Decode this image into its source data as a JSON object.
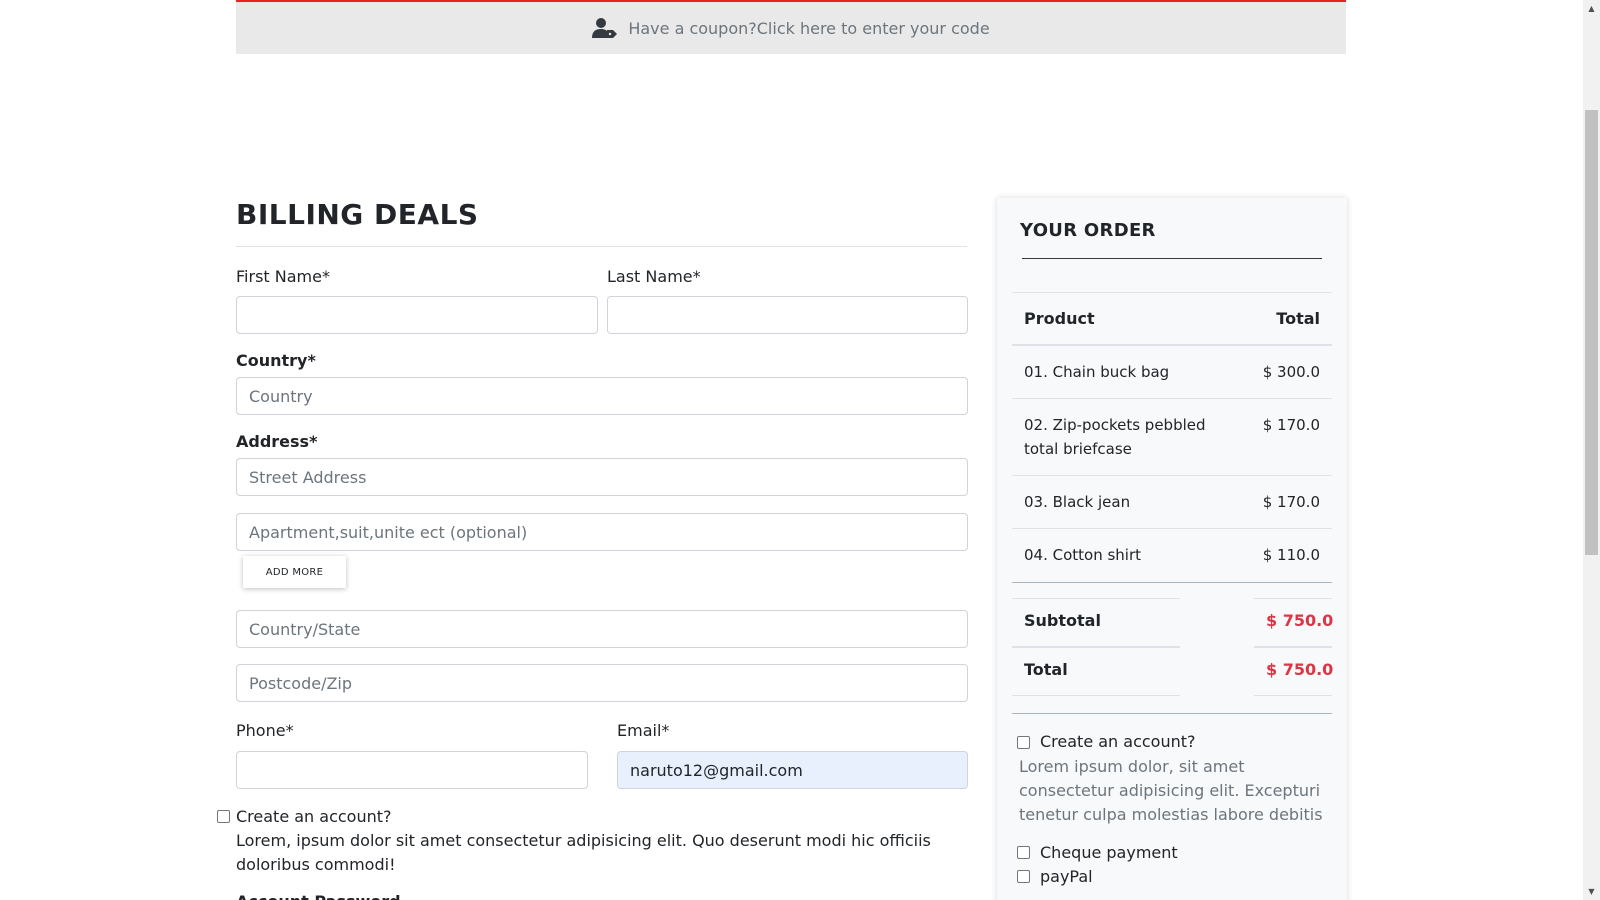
{
  "coupon": {
    "text": "Have a coupon?Click here to enter your code",
    "icon": "user-tag-icon"
  },
  "billing": {
    "title": "BILLING DEALS",
    "first_name_label": "First Name*",
    "last_name_label": "Last Name*",
    "country_label": "Country*",
    "country_placeholder": "Country",
    "address_label": "Address*",
    "street_placeholder": "Street Address",
    "apartment_placeholder": "Apartment,suit,unite ect (optional)",
    "add_more_label": "ADD MORE",
    "state_placeholder": "Country/State",
    "postcode_placeholder": "Postcode/Zip",
    "phone_label": "Phone*",
    "email_label": "Email*",
    "email_value": "naruto12@gmail.com",
    "create_account_label": "Create an account?",
    "create_account_text": "Lorem, ipsum dolor sit amet consectetur adipisicing elit. Quo deserunt modi hic officiis doloribus commodi!",
    "account_password_label": "Account Password"
  },
  "order": {
    "title": "YOUR ORDER",
    "product_header": "Product",
    "total_header": "Total",
    "items": [
      {
        "name": "01. Chain buck bag",
        "price": "$ 300.0"
      },
      {
        "name": "02. Zip-pockets pebbled total briefcase",
        "price": "$ 170.0"
      },
      {
        "name": "03. Black jean",
        "price": "$ 170.0"
      },
      {
        "name": "04. Cotton shirt",
        "price": "$ 110.0"
      }
    ],
    "subtotal_label": "Subtotal",
    "subtotal_value": "$ 750.0",
    "total_label": "Total",
    "total_value": "$ 750.0",
    "create_account_label": "Create an account?",
    "create_account_text": "Lorem ipsum dolor, sit amet consectetur adipisicing elit. Excepturi tenetur culpa molestias labore debitis",
    "cheque_label": "Cheque payment",
    "paypal_label": "payPal"
  },
  "colors": {
    "accent_red": "#dc3545",
    "coupon_border": "#e1261c",
    "coupon_bg": "#e9e9e9",
    "autofill_bg": "#e8f0fe"
  }
}
